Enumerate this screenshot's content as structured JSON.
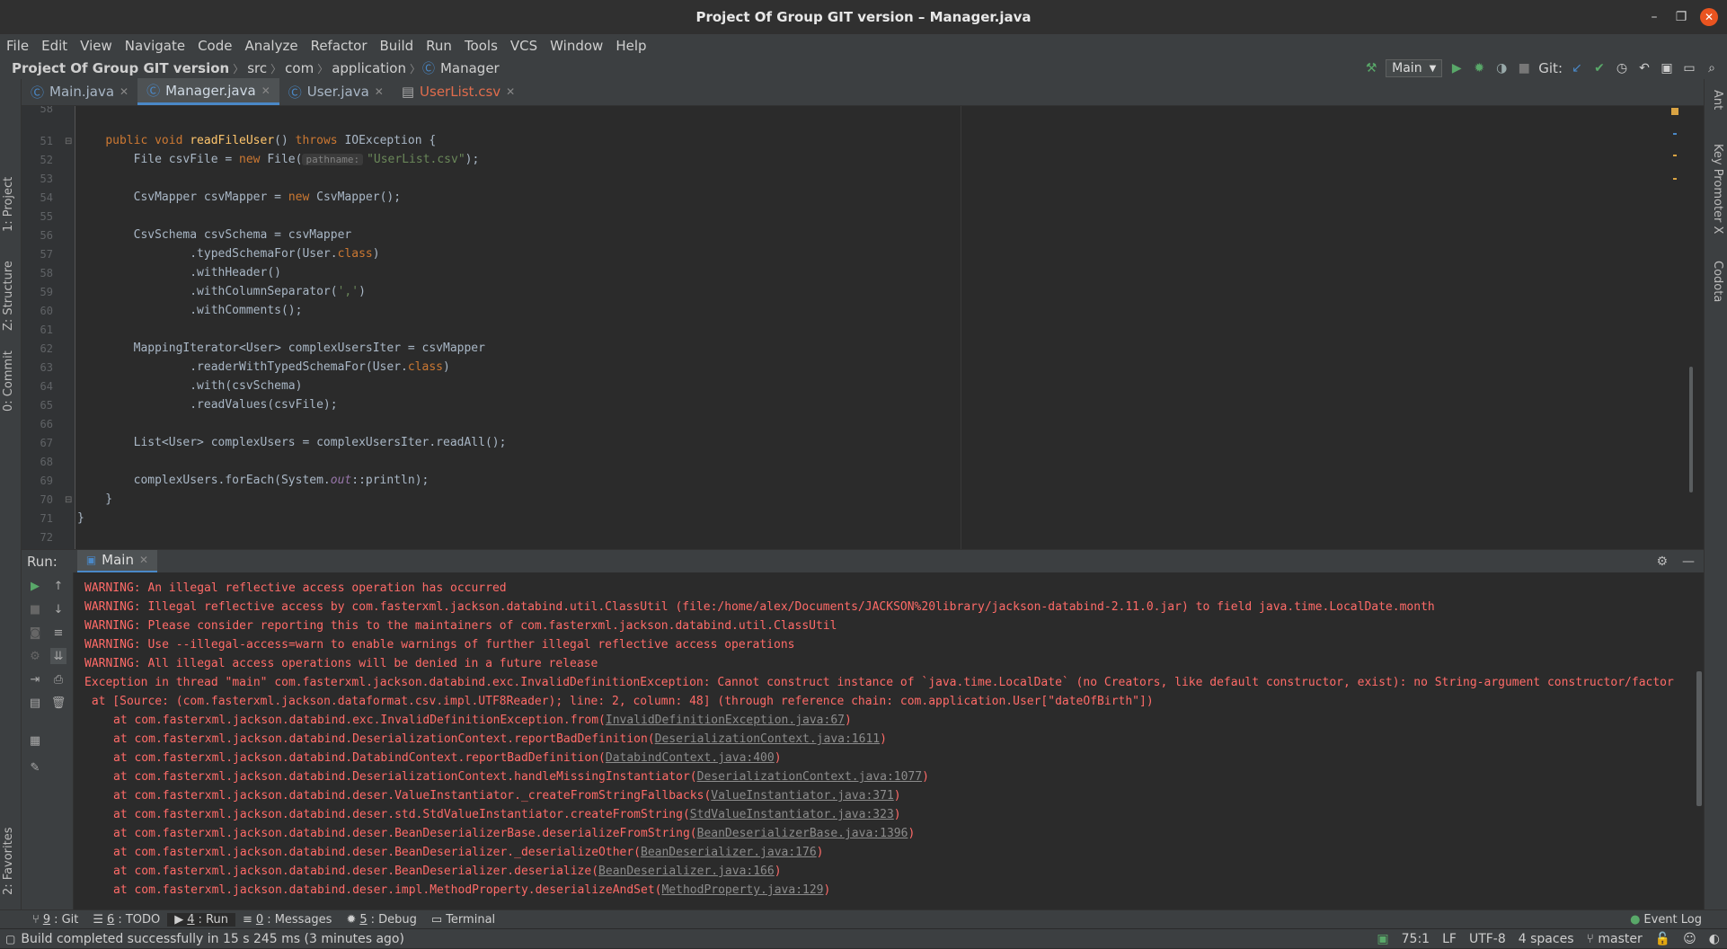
{
  "window": {
    "title": "Project Of Group GIT version – Manager.java"
  },
  "menu": [
    "File",
    "Edit",
    "View",
    "Navigate",
    "Code",
    "Analyze",
    "Refactor",
    "Build",
    "Run",
    "Tools",
    "VCS",
    "Window",
    "Help"
  ],
  "breadcrumb": {
    "project": "Project Of Group GIT version",
    "parts": [
      "src",
      "com",
      "application"
    ],
    "current": "Manager"
  },
  "toolbar": {
    "run_config": "Main",
    "git_label": "Git:"
  },
  "tabs": [
    {
      "label": "Main.java",
      "icon": "java-class-icon"
    },
    {
      "label": "Manager.java",
      "icon": "java-class-icon",
      "active": true
    },
    {
      "label": "User.java",
      "icon": "java-class-icon"
    },
    {
      "label": "UserList.csv",
      "icon": "csv-file-icon"
    }
  ],
  "left_tools": [
    "1: Project",
    "Z: Structure",
    "0: Commit",
    "2: Favorites"
  ],
  "right_tools": [
    "Ant",
    "Key Promoter X",
    "Codota"
  ],
  "editor": {
    "line_numbers": [
      "58",
      "51",
      "52",
      "53",
      "54",
      "55",
      "56",
      "57",
      "58",
      "59",
      "60",
      "61",
      "62",
      "63",
      "64",
      "65",
      "66",
      "67",
      "68",
      "69",
      "70",
      "71",
      "72"
    ],
    "hint_pathname": "pathname:"
  },
  "run": {
    "label": "Run:",
    "tab": "Main",
    "lines": [
      "WARNING: An illegal reflective access operation has occurred",
      "WARNING: Illegal reflective access by com.fasterxml.jackson.databind.util.ClassUtil (file:/home/alex/Documents/JACKSON%20library/jackson-databind-2.11.0.jar) to field java.time.LocalDate.month",
      "WARNING: Please consider reporting this to the maintainers of com.fasterxml.jackson.databind.util.ClassUtil",
      "WARNING: Use --illegal-access=warn to enable warnings of further illegal reflective access operations",
      "WARNING: All illegal access operations will be denied in a future release",
      "Exception in thread \"main\" com.fasterxml.jackson.databind.exc.InvalidDefinitionException: Cannot construct instance of `java.time.LocalDate` (no Creators, like default constructor, exist): no String-argument constructor/factor",
      " at [Source: (com.fasterxml.jackson.dataformat.csv.impl.UTF8Reader); line: 2, column: 48] (through reference chain: com.application.User[\"dateOfBirth\"])"
    ],
    "stack": [
      {
        "text": "at com.fasterxml.jackson.databind.exc.InvalidDefinitionException.from(",
        "link": "InvalidDefinitionException.java:67"
      },
      {
        "text": "at com.fasterxml.jackson.databind.DeserializationContext.reportBadDefinition(",
        "link": "DeserializationContext.java:1611"
      },
      {
        "text": "at com.fasterxml.jackson.databind.DatabindContext.reportBadDefinition(",
        "link": "DatabindContext.java:400"
      },
      {
        "text": "at com.fasterxml.jackson.databind.DeserializationContext.handleMissingInstantiator(",
        "link": "DeserializationContext.java:1077"
      },
      {
        "text": "at com.fasterxml.jackson.databind.deser.ValueInstantiator._createFromStringFallbacks(",
        "link": "ValueInstantiator.java:371"
      },
      {
        "text": "at com.fasterxml.jackson.databind.deser.std.StdValueInstantiator.createFromString(",
        "link": "StdValueInstantiator.java:323"
      },
      {
        "text": "at com.fasterxml.jackson.databind.deser.BeanDeserializerBase.deserializeFromString(",
        "link": "BeanDeserializerBase.java:1396"
      },
      {
        "text": "at com.fasterxml.jackson.databind.deser.BeanDeserializer._deserializeOther(",
        "link": "BeanDeserializer.java:176"
      },
      {
        "text": "at com.fasterxml.jackson.databind.deser.BeanDeserializer.deserialize(",
        "link": "BeanDeserializer.java:166"
      },
      {
        "text": "at com.fasterxml.jackson.databind.deser.impl.MethodProperty.deserializeAndSet(",
        "link": "MethodProperty.java:129"
      }
    ]
  },
  "bottom_tabs": [
    {
      "num": "9",
      "label": ": Git"
    },
    {
      "num": "6",
      "label": ": TODO"
    },
    {
      "num": "4",
      "label": ": Run",
      "active": true
    },
    {
      "num": "0",
      "label": ": Messages"
    },
    {
      "num": "5",
      "label": ": Debug"
    },
    {
      "num": "",
      "label": "Terminal"
    }
  ],
  "event_log": "Event Log",
  "status": {
    "message": "Build completed successfully in 15 s 245 ms (3 minutes ago)",
    "position": "75:1",
    "line_sep": "LF",
    "encoding": "UTF-8",
    "indent": "4 spaces",
    "branch": "master"
  },
  "colors": {
    "error": "#ff6b68",
    "keyword": "#cc7832",
    "method": "#ffc66d",
    "string": "#6a8759",
    "accent": "#4a88c7"
  }
}
